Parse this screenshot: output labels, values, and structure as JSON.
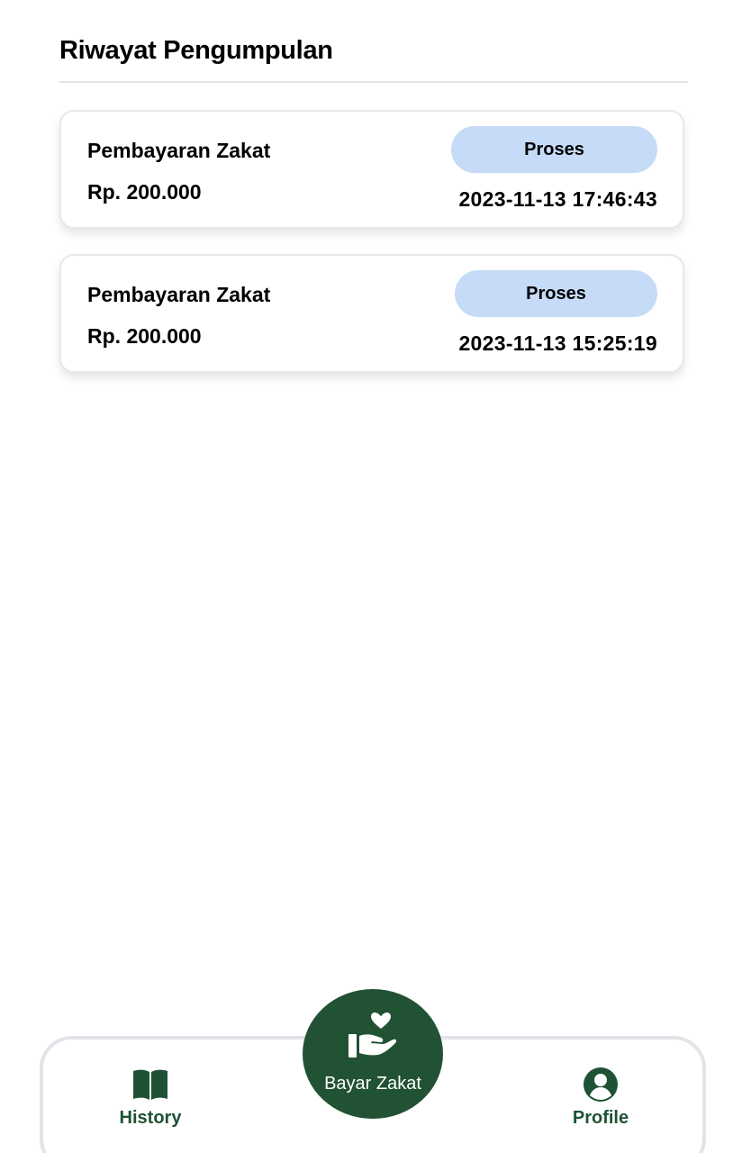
{
  "header": {
    "title": "Riwayat Pengumpulan"
  },
  "history": {
    "items": [
      {
        "title": "Pembayaran Zakat",
        "amount": "Rp. 200.000",
        "status": "Proses",
        "datetime": "2023-11-13 17:46:43"
      },
      {
        "title": "Pembayaran Zakat",
        "amount": "Rp. 200.000",
        "status": "Proses",
        "datetime": "2023-11-13 15:25:19"
      }
    ]
  },
  "bottom_nav": {
    "history_label": "History",
    "history_icon": "book-open-icon",
    "pay_label": "Bayar Zakat",
    "pay_icon": "hand-heart-icon",
    "profile_label": "Profile",
    "profile_icon": "user-circle-icon"
  },
  "colors": {
    "primary": "#215233",
    "badge": "#c6dbf8",
    "border": "#e3e4e9"
  }
}
